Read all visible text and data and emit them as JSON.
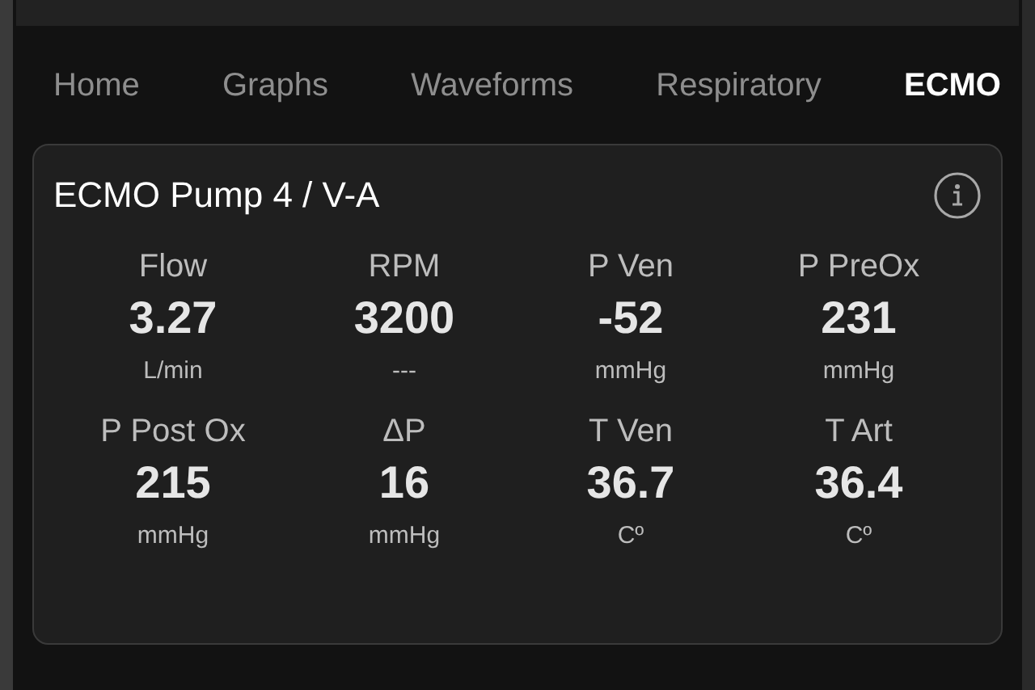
{
  "tabs": [
    {
      "label": "Home",
      "selected": false
    },
    {
      "label": "Graphs",
      "selected": false
    },
    {
      "label": "Waveforms",
      "selected": false
    },
    {
      "label": "Respiratory",
      "selected": false
    },
    {
      "label": "ECMO",
      "selected": true
    }
  ],
  "card": {
    "title": "ECMO Pump 4 / V-A",
    "metrics": [
      {
        "label": "Flow",
        "value": "3.27",
        "unit": "L/min"
      },
      {
        "label": "RPM",
        "value": "3200",
        "unit": "---"
      },
      {
        "label": "P Ven",
        "value": "-52",
        "unit": "mmHg"
      },
      {
        "label": "P PreOx",
        "value": "231",
        "unit": "mmHg"
      },
      {
        "label": "P Post Ox",
        "value": "215",
        "unit": "mmHg"
      },
      {
        "label": "ΔP",
        "value": "16",
        "unit": "mmHg"
      },
      {
        "label": "T Ven",
        "value": "36.7",
        "unit": "Cº"
      },
      {
        "label": "T Art",
        "value": "36.4",
        "unit": "Cº"
      }
    ]
  }
}
